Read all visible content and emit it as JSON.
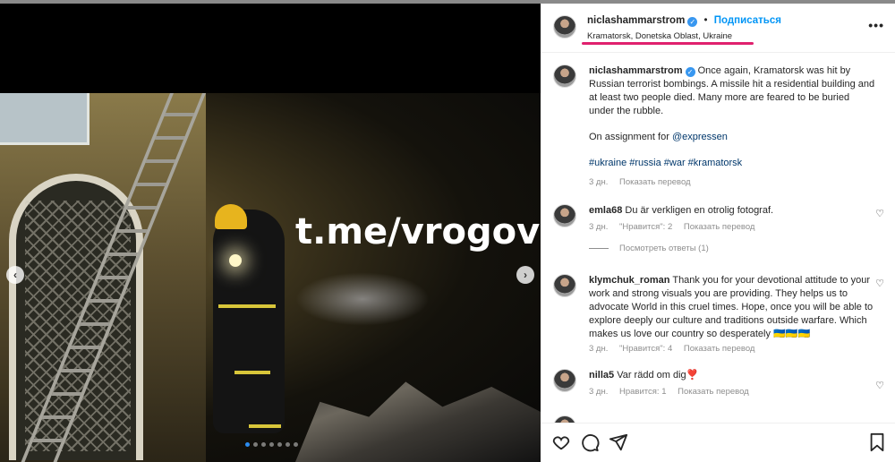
{
  "post": {
    "username": "niclashammarstrom",
    "follow_label": "Подписаться",
    "separator": "•",
    "location": "Kramatorsk, Donetska Oblast, Ukraine",
    "more_label": "•••",
    "watermark": "t.me/vrogov",
    "carousel": {
      "total": 7,
      "active": 0
    }
  },
  "caption": {
    "username": "niclashammarstrom",
    "text": "Once again, Kramatorsk was hit by Russian terrorist bombings. A missile hit a residential building and at least two people died. Many more are feared to be buried under the rubble.",
    "assignment_prefix": "On assignment for ",
    "assignment_mention": "@expressen",
    "hashtags": "#ukraine #russia #war #kramatorsk",
    "time": "3 дн.",
    "translate": "Показать перевод"
  },
  "comments": [
    {
      "username": "emla68",
      "text": "Du är verkligen en otrolig fotograf.",
      "time": "3 дн.",
      "likes": "\"Нравится\": 2",
      "translate": "Показать перевод",
      "replies": "Посмотреть ответы (1)"
    },
    {
      "username": "klymchuk_roman",
      "text": "Thank you for your devotional attitude to your work and strong visuals you are providing. They helps us to advocate World in this cruel times. Hope, once you will be able to explore deeply our culture and traditions outside warfare. Which makes us love our country so desperately 🇺🇦🇺🇦🇺🇦",
      "time": "3 дн.",
      "likes": "\"Нравится\": 4",
      "translate": "Показать перевод"
    },
    {
      "username": "nilla5",
      "text": "Var rädd om dig❣️",
      "time": "3 дн.",
      "likes": "Нравится: 1",
      "translate": "Показать перевод"
    }
  ],
  "icons": {
    "like": "heart-icon",
    "comment": "comment-icon",
    "share": "share-icon",
    "save": "bookmark-icon",
    "verified": "verified-badge-icon",
    "options": "more-options-icon"
  },
  "colors": {
    "accent": "#0095f6",
    "verified": "#3897f0",
    "annotation_underline": "#e0206e",
    "muted": "#8e8e8e"
  }
}
